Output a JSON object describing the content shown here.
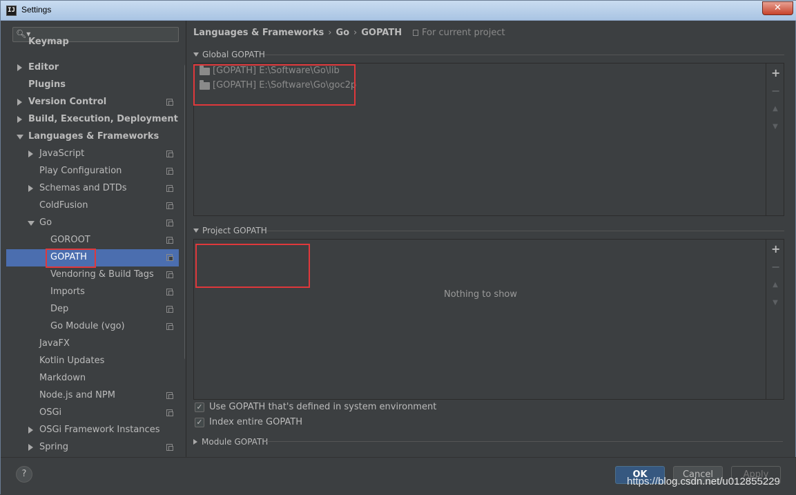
{
  "window": {
    "title": "Settings",
    "app_icon": "IJ",
    "close_glyph": "✕"
  },
  "search": {
    "placeholder": ""
  },
  "sidebar": {
    "items": [
      {
        "label": "Keymap"
      },
      {
        "label": "Editor"
      },
      {
        "label": "Plugins"
      },
      {
        "label": "Version Control"
      },
      {
        "label": "Build, Execution, Deployment"
      },
      {
        "label": "Languages & Frameworks"
      },
      {
        "label": "JavaScript"
      },
      {
        "label": "Play Configuration"
      },
      {
        "label": "Schemas and DTDs"
      },
      {
        "label": "ColdFusion"
      },
      {
        "label": "Go"
      },
      {
        "label": "GOROOT"
      },
      {
        "label": "GOPATH"
      },
      {
        "label": "Vendoring & Build Tags"
      },
      {
        "label": "Imports"
      },
      {
        "label": "Dep"
      },
      {
        "label": "Go Module (vgo)"
      },
      {
        "label": "JavaFX"
      },
      {
        "label": "Kotlin Updates"
      },
      {
        "label": "Markdown"
      },
      {
        "label": "Node.js and NPM"
      },
      {
        "label": "OSGi"
      },
      {
        "label": "OSGi Framework Instances"
      },
      {
        "label": "Spring"
      }
    ]
  },
  "breadcrumb": {
    "part1": "Languages & Frameworks",
    "part2": "Go",
    "part3": "GOPATH",
    "separator": "›"
  },
  "scope": {
    "label": "For current project"
  },
  "global_gopath": {
    "header": "Global GOPATH",
    "paths": [
      "[GOPATH] E:\\Software\\Go\\lib",
      "[GOPATH] E:\\Software\\Go\\goc2p"
    ]
  },
  "project_gopath": {
    "header": "Project GOPATH",
    "empty_text": "Nothing to show"
  },
  "toolbar": {
    "add": "+",
    "remove": "−",
    "up": "▲",
    "down": "▼"
  },
  "options": {
    "use_system_gopath": {
      "label": "Use GOPATH that's defined in system environment",
      "checked": true
    },
    "index_entire": {
      "label": "Index entire GOPATH",
      "checked": true
    }
  },
  "module_gopath": {
    "header": "Module GOPATH"
  },
  "buttons": {
    "help": "?",
    "ok": "OK",
    "cancel": "Cancel",
    "apply": "Apply"
  },
  "watermark": "https://blog.csdn.net/u012855229",
  "colors": {
    "selection": "#4b6eaf",
    "annotation": "#e0383b",
    "ok_button": "#365880"
  }
}
